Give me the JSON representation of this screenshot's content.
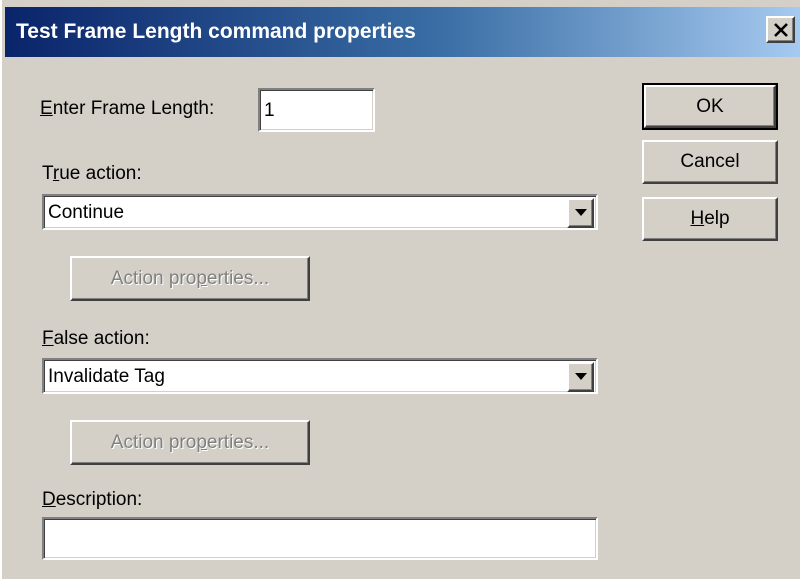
{
  "window": {
    "title": "Test Frame Length command properties"
  },
  "frame_length": {
    "label_mnemonic": "E",
    "label_rest": "nter Frame Length:",
    "value": "1"
  },
  "true_action": {
    "label_pre": "T",
    "label_mnemonic": "r",
    "label_post": "ue action:",
    "selected": "Continue",
    "properties_button": {
      "pre": "Action pro",
      "mnemonic": "p",
      "post": "erties..."
    }
  },
  "false_action": {
    "label_mnemonic": "F",
    "label_post": "alse action:",
    "selected": "Invalidate Tag",
    "properties_button": {
      "pre": "Action pro",
      "mnemonic": "p",
      "post": "erties..."
    }
  },
  "description": {
    "label_mnemonic": "D",
    "label_post": "escription:",
    "value": ""
  },
  "buttons": {
    "ok": "OK",
    "cancel": "Cancel",
    "help_mnemonic": "H",
    "help_rest": "elp"
  },
  "icons": {
    "close": "close-icon",
    "dropdown": "chevron-down-icon"
  },
  "colors": {
    "titlebar_start": "#0a246a",
    "titlebar_end": "#a6caf0",
    "dialog_face": "#d4d0c8"
  }
}
